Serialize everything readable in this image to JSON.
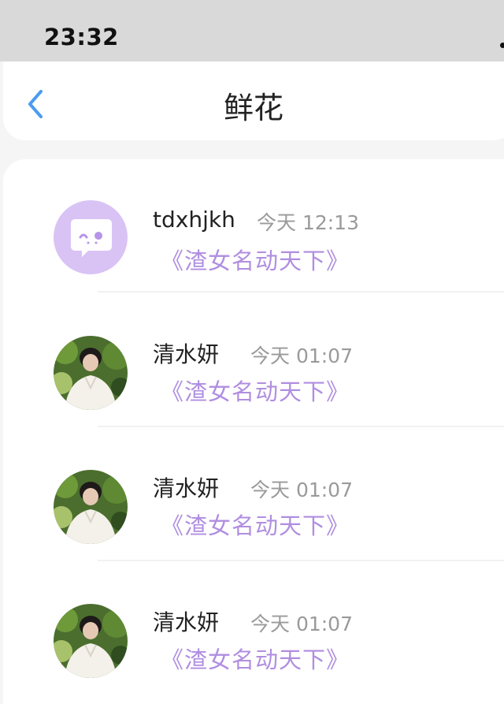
{
  "status_bar": {
    "time": "23:32"
  },
  "header": {
    "title": "鲜花",
    "back_icon": "chevron-left-icon"
  },
  "accent_color": "#4a9cf0",
  "link_color": "#b08ee0",
  "list": [
    {
      "name": "tdxhjkh",
      "time": "今天 12:13",
      "book": "《渣女名动天下》",
      "avatar": "chat-bubble-avatar-icon"
    },
    {
      "name": "清水妍",
      "time": "今天 01:07",
      "book": "《渣女名动天下》",
      "avatar": "user-photo-avatar"
    },
    {
      "name": "清水妍",
      "time": "今天 01:07",
      "book": "《渣女名动天下》",
      "avatar": "user-photo-avatar"
    },
    {
      "name": "清水妍",
      "time": "今天 01:07",
      "book": "《渣女名动天下》",
      "avatar": "user-photo-avatar"
    }
  ]
}
